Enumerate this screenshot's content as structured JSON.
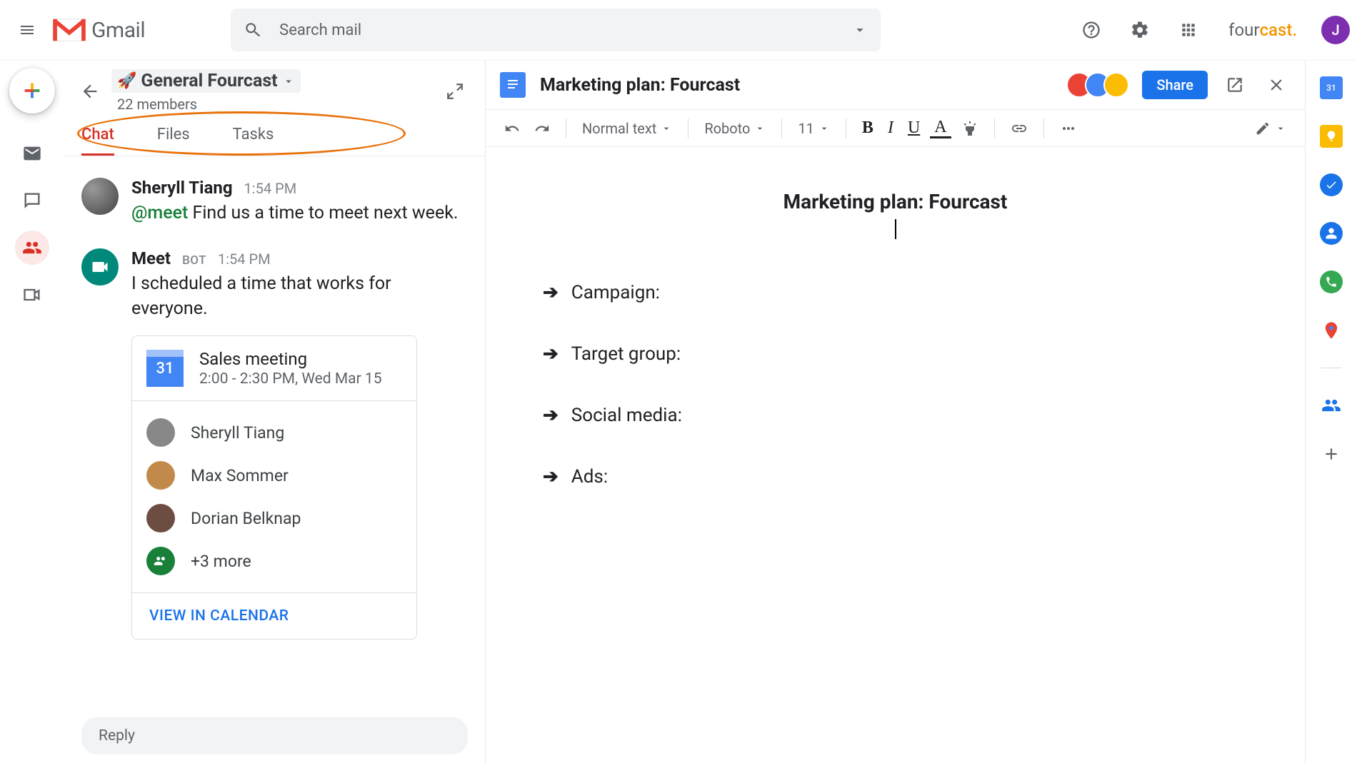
{
  "header": {
    "app_name": "Gmail",
    "search_placeholder": "Search mail",
    "brand_part1": "four",
    "brand_part2": "cast.",
    "avatar_initial": "J"
  },
  "room": {
    "emoji": "🚀",
    "name": "General Fourcast",
    "members": "22 members",
    "tabs": [
      "Chat",
      "Files",
      "Tasks"
    ]
  },
  "messages": [
    {
      "author": "Sheryll Tiang",
      "time": "1:54 PM",
      "mention": "@meet",
      "text": " Find us a time to meet next week."
    },
    {
      "author": "Meet",
      "bot_label": "BOT",
      "time": "1:54 PM",
      "text": "I scheduled a time that works for everyone."
    }
  ],
  "event_card": {
    "cal_day": "31",
    "title": "Sales meeting",
    "time": "2:00 - 2:30 PM, Wed Mar 15",
    "attendees": [
      "Sheryll Tiang",
      "Max Sommer",
      "Dorian Belknap"
    ],
    "more": "+3 more",
    "action": "VIEW IN CALENDAR"
  },
  "reply_placeholder": "Reply",
  "doc": {
    "title": "Marketing plan: Fourcast",
    "share": "Share",
    "toolbar": {
      "style": "Normal text",
      "font": "Roboto",
      "size": "11"
    },
    "page_title": "Marketing plan: Fourcast",
    "bullets": [
      "Campaign:",
      "Target group:",
      "Social media:",
      "Ads:"
    ]
  },
  "rightrail": {
    "cal_day": "31"
  }
}
